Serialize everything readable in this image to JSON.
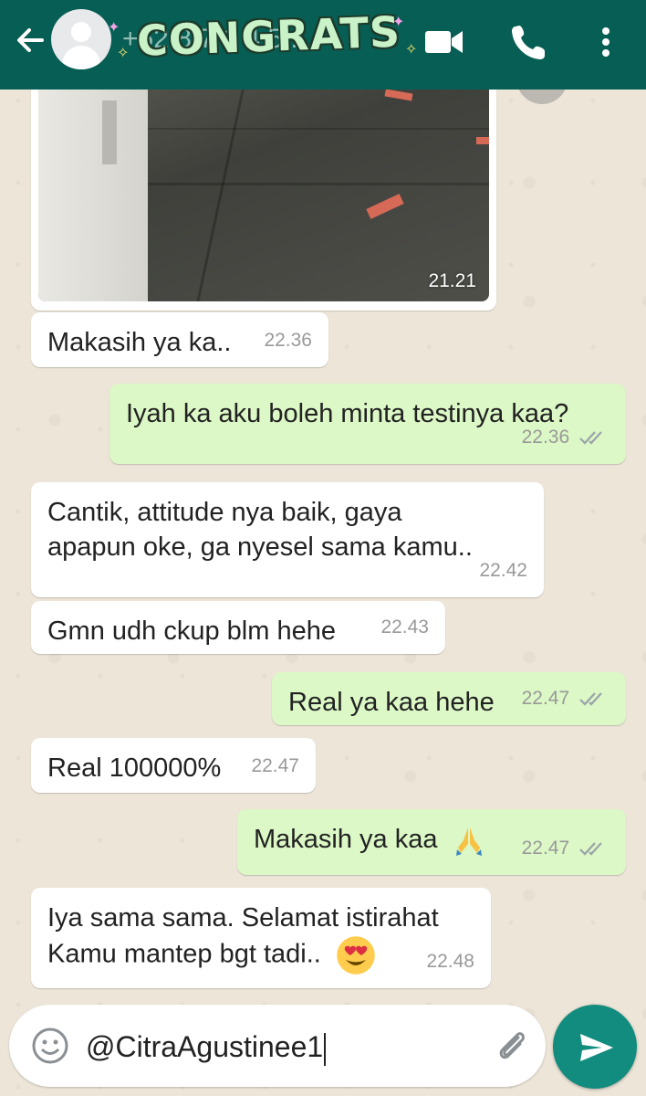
{
  "header": {
    "contact_name": "+62 8 7 1 4 5 ...",
    "sticker_text": "CONGRATS"
  },
  "colors": {
    "header": "#075e54",
    "incoming": "#ffffff",
    "outgoing": "#dcf8c6",
    "send": "#128c7e",
    "ticks": "#9aa3a8"
  },
  "image_message": {
    "time": "21.21"
  },
  "messages": [
    {
      "dir": "in",
      "text": "Makasih ya ka..",
      "time": "22.36"
    },
    {
      "dir": "out",
      "text": "Iyah ka aku boleh minta testinya kaa?",
      "time": "22.36"
    },
    {
      "dir": "in",
      "lines": [
        "Cantik, attitude nya baik,  gaya",
        "apapun oke, ga nyesel sama kamu.."
      ],
      "time": "22.42"
    },
    {
      "dir": "in",
      "text": "Gmn udh ckup blm hehe",
      "time": "22.43"
    },
    {
      "dir": "out",
      "text": "Real ya kaa hehe",
      "time": "22.47"
    },
    {
      "dir": "in",
      "text": "Real 100000%",
      "time": "22.47"
    },
    {
      "dir": "out",
      "text": "Makasih ya kaa",
      "time": "22.47",
      "emoji": "folded-hands-emoji"
    },
    {
      "dir": "in",
      "lines": [
        "Iya sama sama. Selamat istirahat",
        "Kamu mantep bgt tadi.."
      ],
      "time": "22.48",
      "emoji": "heart-eyes-emoji"
    }
  ],
  "composer": {
    "value": "@CitraAgustinee1"
  }
}
